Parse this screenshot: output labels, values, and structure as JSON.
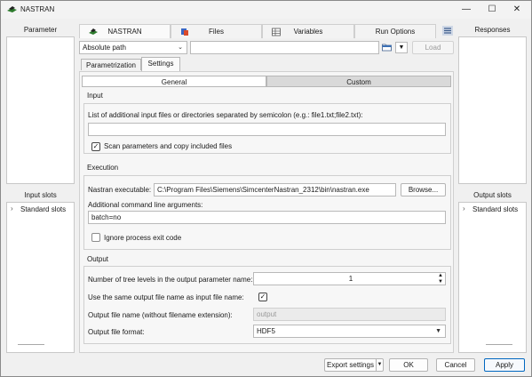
{
  "window": {
    "title": "NASTRAN",
    "minimize": "—",
    "maximize": "☐",
    "close": "✕"
  },
  "left": {
    "parameter_title": "Parameter",
    "input_slots_title": "Input slots",
    "tree": {
      "expander": "›",
      "label": "Standard slots"
    }
  },
  "right": {
    "responses_title": "Responses",
    "output_slots_title": "Output slots",
    "tree": {
      "expander": "›",
      "label": "Standard slots"
    }
  },
  "tabs": [
    {
      "label": "NASTRAN",
      "icon": "nastran-icon"
    },
    {
      "label": "Files",
      "icon": "files-icon"
    },
    {
      "label": "Variables",
      "icon": "variables-icon"
    },
    {
      "label": "Run Options",
      "icon": "run-options-icon"
    }
  ],
  "pathbar": {
    "mode": "Absolute path",
    "path_value": "",
    "load_label": "Load"
  },
  "subtabs": {
    "parametrization": "Parametrization",
    "settings": "Settings"
  },
  "settings_tabs": {
    "general": "General",
    "custom": "Custom"
  },
  "input_group": {
    "title": "Input",
    "files_label": "List of additional input files or directories separated by semicolon (e.g.: file1.txt;file2.txt):",
    "files_value": "",
    "scan_checked": true,
    "scan_label": "Scan parameters and copy included files"
  },
  "execution_group": {
    "title": "Execution",
    "exe_label": "Nastran executable:",
    "exe_value": "C:\\Program Files\\Siemens\\SimcenterNastran_2312\\bin\\nastran.exe",
    "browse_label": "Browse...",
    "args_label": "Additional command line arguments:",
    "args_value": "batch=no",
    "ignore_checked": false,
    "ignore_label": "Ignore process exit code"
  },
  "output_group": {
    "title": "Output",
    "levels_label": "Number of tree levels in the output parameter name:",
    "levels_value": "1",
    "same_name_label": "Use the same output file name as input file name:",
    "same_name_checked": true,
    "file_name_label": "Output file name (without filename extension):",
    "file_name_placeholder": "output",
    "format_label": "Output file format:",
    "format_value": "HDF5"
  },
  "footer": {
    "export_label": "Export settings",
    "ok_label": "OK",
    "cancel_label": "Cancel",
    "apply_label": "Apply"
  },
  "colors": {
    "accent": "#0067c0",
    "panel_bg": "#f0f0f0"
  }
}
